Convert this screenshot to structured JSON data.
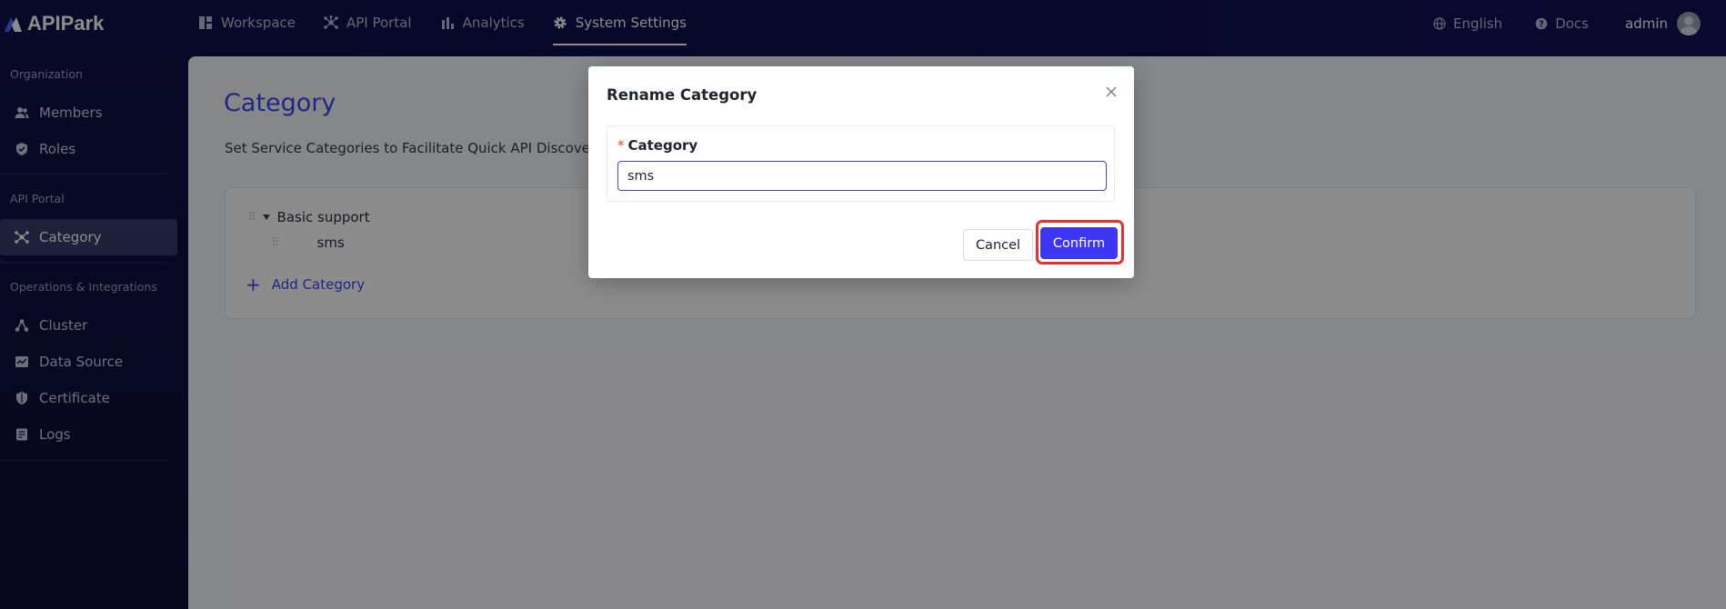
{
  "app": {
    "logo_text": "APIPark"
  },
  "topnav": {
    "items": [
      {
        "label": "Workspace",
        "icon": "dashboard-icon"
      },
      {
        "label": "API Portal",
        "icon": "hub-icon"
      },
      {
        "label": "Analytics",
        "icon": "bar-chart-icon"
      },
      {
        "label": "System Settings",
        "icon": "gear-icon",
        "active": true
      }
    ],
    "language": "English",
    "docs": "Docs",
    "user": "admin"
  },
  "sidebar": {
    "groups": [
      {
        "title": "Organization",
        "items": [
          {
            "label": "Members",
            "icon": "users-icon"
          },
          {
            "label": "Roles",
            "icon": "shield-check-icon"
          }
        ]
      },
      {
        "title": "API Portal",
        "items": [
          {
            "label": "Category",
            "icon": "hub-icon",
            "active": true
          }
        ]
      },
      {
        "title": "Operations & Integrations",
        "items": [
          {
            "label": "Cluster",
            "icon": "cluster-icon"
          },
          {
            "label": "Data Source",
            "icon": "data-source-icon"
          },
          {
            "label": "Certificate",
            "icon": "shield-icon"
          },
          {
            "label": "Logs",
            "icon": "logs-icon"
          }
        ]
      }
    ]
  },
  "main": {
    "title": "Category",
    "description": "Set Service Categories to Facilitate Quick API Discovery by Tea",
    "tree": {
      "parent": "Basic support",
      "child": "sms",
      "add_label": "Add Category"
    }
  },
  "modal": {
    "title": "Rename Category",
    "field_label": "Category",
    "field_required_mark": "*",
    "field_value": "sms",
    "cancel_label": "Cancel",
    "confirm_label": "Confirm"
  },
  "colors": {
    "accent": "#3d46f2",
    "confirm": "#3d37f5",
    "highlight": "#e8302c",
    "topbar": "#10124a"
  }
}
